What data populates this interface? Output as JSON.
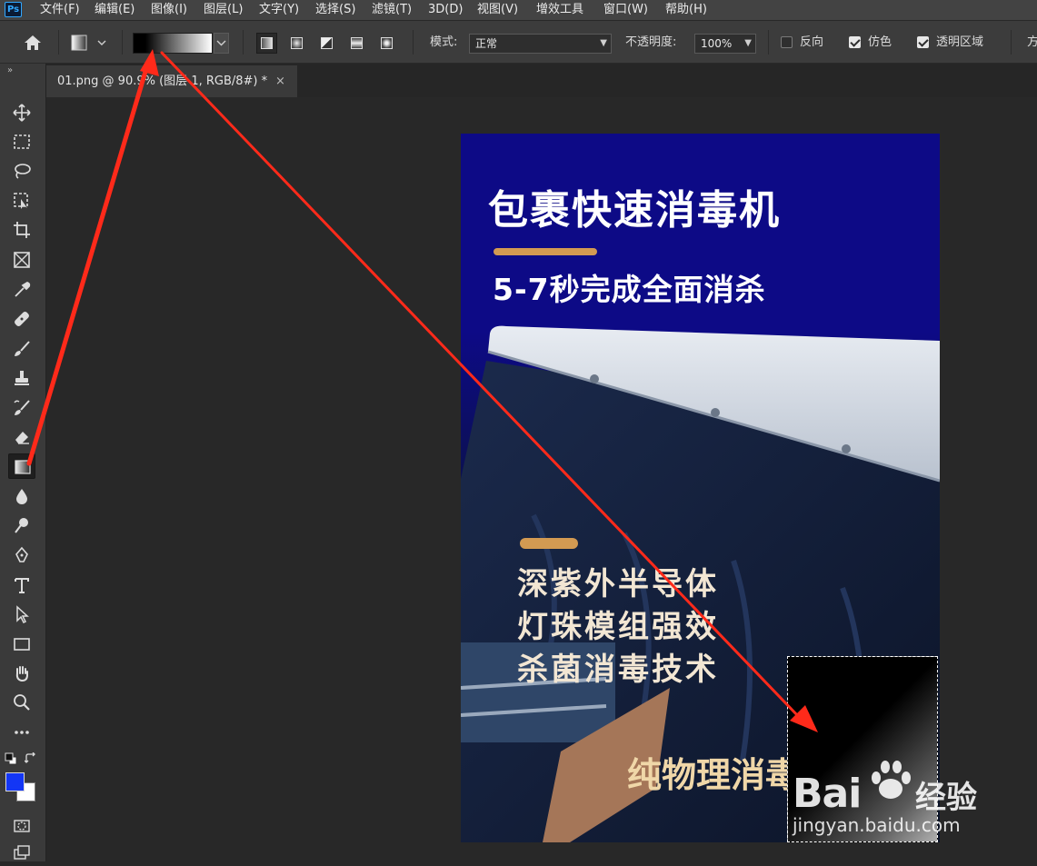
{
  "app": {
    "logo": "Ps"
  },
  "menu": {
    "items": [
      "文件(F)",
      "编辑(E)",
      "图像(I)",
      "图层(L)",
      "文字(Y)",
      "选择(S)",
      "滤镜(T)",
      "3D(D)",
      "视图(V)",
      "增效工具",
      "窗口(W)",
      "帮助(H)"
    ]
  },
  "options": {
    "mode_label": "模式:",
    "mode_value": "正常",
    "opacity_label": "不透明度:",
    "opacity_value": "100%",
    "reverse_label": "反向",
    "reverse_checked": false,
    "dither_label": "仿色",
    "dither_checked": true,
    "transparency_label": "透明区域",
    "transparency_checked": true,
    "overflow_label": "方"
  },
  "document": {
    "tab_title": "01.png @ 90.9% (图层 1, RGB/8#) *",
    "close_glyph": "×"
  },
  "poster": {
    "title": "包裹快速消毒机",
    "subtitle": "5-7秒完成全面消杀",
    "lines": [
      "深紫外半导体",
      "灯珠模组强效",
      "杀菌消毒技术"
    ],
    "tag": "纯物理消毒"
  },
  "colors": {
    "foreground": "#1336f5",
    "background": "#ffffff",
    "annotation_arrows": "#ff2a1a"
  },
  "watermark": {
    "brand": "Bai",
    "paw": "paw-icon",
    "brand2": "经验",
    "url": "jingyan.baidu.com"
  },
  "tools": [
    "move-tool-icon",
    "marquee-tool-icon",
    "lasso-tool-icon",
    "object-select-tool-icon",
    "crop-tool-icon",
    "frame-tool-icon",
    "eyedropper-tool-icon",
    "healing-brush-tool-icon",
    "brush-tool-icon",
    "clone-stamp-tool-icon",
    "history-brush-tool-icon",
    "eraser-tool-icon",
    "gradient-tool-icon",
    "blur-tool-icon",
    "dodge-tool-icon",
    "pen-tool-icon",
    "type-tool-icon",
    "path-select-tool-icon",
    "rectangle-tool-icon",
    "hand-tool-icon",
    "zoom-tool-icon",
    "more-tools-icon"
  ]
}
